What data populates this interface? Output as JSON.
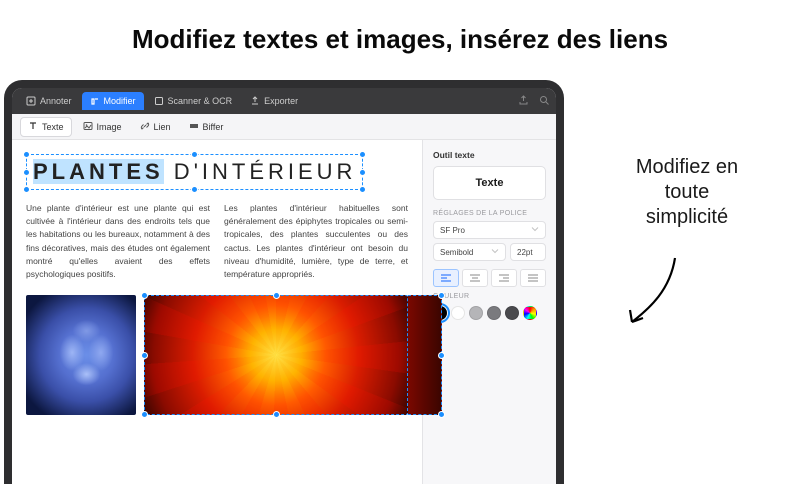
{
  "hero": {
    "title": "Modifiez textes et images, insérez des liens"
  },
  "callout": {
    "text": "Modifiez en toute simplicité"
  },
  "top_tabs": {
    "annoter": "Annoter",
    "modifier": "Modifier",
    "scanner": "Scanner & OCR",
    "exporter": "Exporter"
  },
  "sub_tabs": {
    "texte": "Texte",
    "image": "Image",
    "lien": "Lien",
    "biffer": "Biffer"
  },
  "doc": {
    "title_bold": "PLANTES",
    "title_rest": " D'INTÉRIEUR",
    "col1": "Une plante d'intérieur est une plante qui est cultivée à l'intérieur dans des endroits tels que les habitations ou les bureaux, notamment à des fins décoratives, mais des études ont également montré qu'elles avaient des effets psychologiques positifs.",
    "col2": "Les plantes d'intérieur habituelles sont généralement des épiphytes tropicales ou semi-tropicales, des plantes succulentes ou des cactus. Les plantes d'intérieur ont besoin du niveau d'humidité, lumière, type de terre, et température appropriés."
  },
  "panel": {
    "title": "Outil texte",
    "text_sample": "Texte",
    "font_section": "RÉGLAGES DE LA POLICE",
    "font_family": "SF Pro",
    "font_weight": "Semibold",
    "font_size": "22pt",
    "color_section": "COULEUR",
    "colors": [
      "#000000",
      "#ffffff",
      "#a0a0a0",
      "#6b6b6b",
      "#3b3b3b"
    ]
  }
}
